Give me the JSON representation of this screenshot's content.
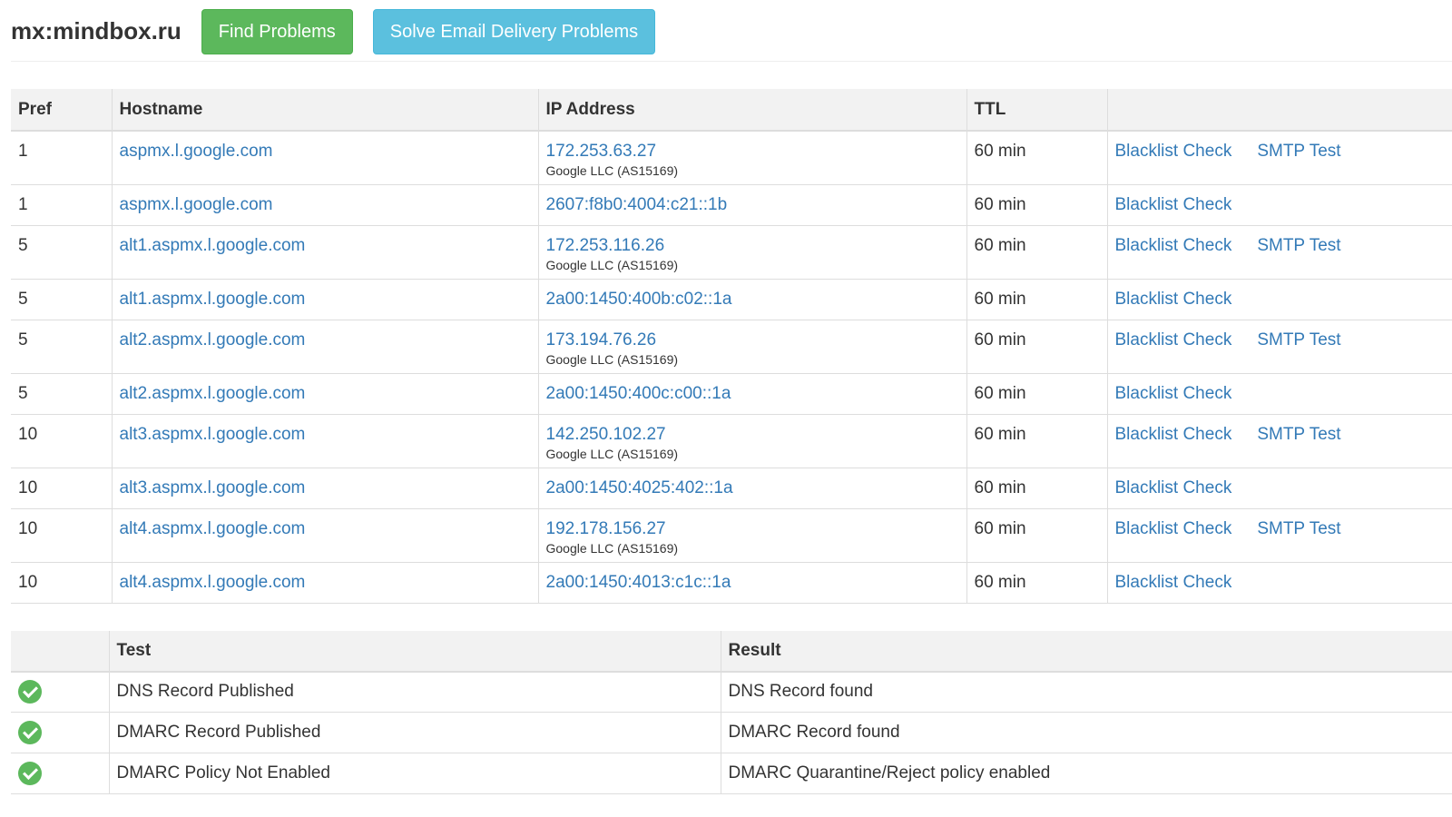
{
  "header": {
    "title": "mx:mindbox.ru",
    "find_problems_label": "Find Problems",
    "solve_label": "Solve Email Delivery Problems"
  },
  "mx_table": {
    "columns": [
      "Pref",
      "Hostname",
      "IP Address",
      "TTL",
      ""
    ],
    "rows": [
      {
        "pref": "1",
        "hostname": "aspmx.l.google.com",
        "ip": "172.253.63.27",
        "asn": "Google LLC (AS15169)",
        "ttl": "60 min",
        "blacklist": "Blacklist Check",
        "smtp": "SMTP Test"
      },
      {
        "pref": "1",
        "hostname": "aspmx.l.google.com",
        "ip": "2607:f8b0:4004:c21::1b",
        "asn": "",
        "ttl": "60 min",
        "blacklist": "Blacklist Check",
        "smtp": ""
      },
      {
        "pref": "5",
        "hostname": "alt1.aspmx.l.google.com",
        "ip": "172.253.116.26",
        "asn": "Google LLC (AS15169)",
        "ttl": "60 min",
        "blacklist": "Blacklist Check",
        "smtp": "SMTP Test"
      },
      {
        "pref": "5",
        "hostname": "alt1.aspmx.l.google.com",
        "ip": "2a00:1450:400b:c02::1a",
        "asn": "",
        "ttl": "60 min",
        "blacklist": "Blacklist Check",
        "smtp": ""
      },
      {
        "pref": "5",
        "hostname": "alt2.aspmx.l.google.com",
        "ip": "173.194.76.26",
        "asn": "Google LLC (AS15169)",
        "ttl": "60 min",
        "blacklist": "Blacklist Check",
        "smtp": "SMTP Test"
      },
      {
        "pref": "5",
        "hostname": "alt2.aspmx.l.google.com",
        "ip": "2a00:1450:400c:c00::1a",
        "asn": "",
        "ttl": "60 min",
        "blacklist": "Blacklist Check",
        "smtp": ""
      },
      {
        "pref": "10",
        "hostname": "alt3.aspmx.l.google.com",
        "ip": "142.250.102.27",
        "asn": "Google LLC (AS15169)",
        "ttl": "60 min",
        "blacklist": "Blacklist Check",
        "smtp": "SMTP Test"
      },
      {
        "pref": "10",
        "hostname": "alt3.aspmx.l.google.com",
        "ip": "2a00:1450:4025:402::1a",
        "asn": "",
        "ttl": "60 min",
        "blacklist": "Blacklist Check",
        "smtp": ""
      },
      {
        "pref": "10",
        "hostname": "alt4.aspmx.l.google.com",
        "ip": "192.178.156.27",
        "asn": "Google LLC (AS15169)",
        "ttl": "60 min",
        "blacklist": "Blacklist Check",
        "smtp": "SMTP Test"
      },
      {
        "pref": "10",
        "hostname": "alt4.aspmx.l.google.com",
        "ip": "2a00:1450:4013:c1c::1a",
        "asn": "",
        "ttl": "60 min",
        "blacklist": "Blacklist Check",
        "smtp": ""
      }
    ]
  },
  "test_table": {
    "columns": [
      "",
      "Test",
      "Result"
    ],
    "rows": [
      {
        "status": "check-circle-icon",
        "status_color": "#5cb85c",
        "test": "DNS Record Published",
        "result": "DNS Record found"
      },
      {
        "status": "check-circle-icon",
        "status_color": "#5cb85c",
        "test": "DMARC Record Published",
        "result": "DMARC Record found"
      },
      {
        "status": "check-circle-icon",
        "status_color": "#5cb85c",
        "test": "DMARC Policy Not Enabled",
        "result": "DMARC Quarantine/Reject policy enabled"
      }
    ]
  },
  "colors": {
    "link": "#337ab7",
    "green_button": "#5cb85c",
    "blue_button": "#5bc0de",
    "header_bg": "#f2f2f2"
  }
}
